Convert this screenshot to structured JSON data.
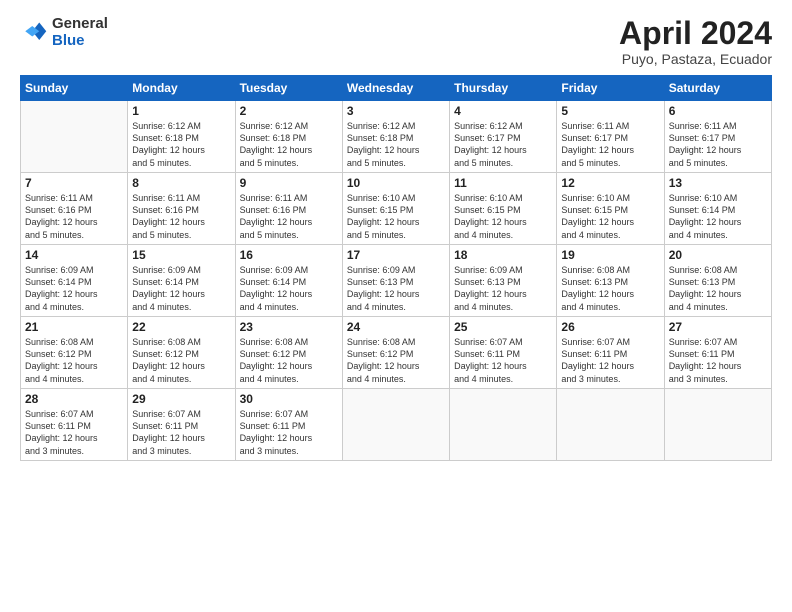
{
  "logo": {
    "general": "General",
    "blue": "Blue"
  },
  "title": {
    "month": "April 2024",
    "location": "Puyo, Pastaza, Ecuador"
  },
  "weekdays": [
    "Sunday",
    "Monday",
    "Tuesday",
    "Wednesday",
    "Thursday",
    "Friday",
    "Saturday"
  ],
  "weeks": [
    [
      {
        "day": "",
        "info": ""
      },
      {
        "day": "1",
        "info": "Sunrise: 6:12 AM\nSunset: 6:18 PM\nDaylight: 12 hours\nand 5 minutes."
      },
      {
        "day": "2",
        "info": "Sunrise: 6:12 AM\nSunset: 6:18 PM\nDaylight: 12 hours\nand 5 minutes."
      },
      {
        "day": "3",
        "info": "Sunrise: 6:12 AM\nSunset: 6:18 PM\nDaylight: 12 hours\nand 5 minutes."
      },
      {
        "day": "4",
        "info": "Sunrise: 6:12 AM\nSunset: 6:17 PM\nDaylight: 12 hours\nand 5 minutes."
      },
      {
        "day": "5",
        "info": "Sunrise: 6:11 AM\nSunset: 6:17 PM\nDaylight: 12 hours\nand 5 minutes."
      },
      {
        "day": "6",
        "info": "Sunrise: 6:11 AM\nSunset: 6:17 PM\nDaylight: 12 hours\nand 5 minutes."
      }
    ],
    [
      {
        "day": "7",
        "info": "Sunrise: 6:11 AM\nSunset: 6:16 PM\nDaylight: 12 hours\nand 5 minutes."
      },
      {
        "day": "8",
        "info": "Sunrise: 6:11 AM\nSunset: 6:16 PM\nDaylight: 12 hours\nand 5 minutes."
      },
      {
        "day": "9",
        "info": "Sunrise: 6:11 AM\nSunset: 6:16 PM\nDaylight: 12 hours\nand 5 minutes."
      },
      {
        "day": "10",
        "info": "Sunrise: 6:10 AM\nSunset: 6:15 PM\nDaylight: 12 hours\nand 5 minutes."
      },
      {
        "day": "11",
        "info": "Sunrise: 6:10 AM\nSunset: 6:15 PM\nDaylight: 12 hours\nand 4 minutes."
      },
      {
        "day": "12",
        "info": "Sunrise: 6:10 AM\nSunset: 6:15 PM\nDaylight: 12 hours\nand 4 minutes."
      },
      {
        "day": "13",
        "info": "Sunrise: 6:10 AM\nSunset: 6:14 PM\nDaylight: 12 hours\nand 4 minutes."
      }
    ],
    [
      {
        "day": "14",
        "info": "Sunrise: 6:09 AM\nSunset: 6:14 PM\nDaylight: 12 hours\nand 4 minutes."
      },
      {
        "day": "15",
        "info": "Sunrise: 6:09 AM\nSunset: 6:14 PM\nDaylight: 12 hours\nand 4 minutes."
      },
      {
        "day": "16",
        "info": "Sunrise: 6:09 AM\nSunset: 6:14 PM\nDaylight: 12 hours\nand 4 minutes."
      },
      {
        "day": "17",
        "info": "Sunrise: 6:09 AM\nSunset: 6:13 PM\nDaylight: 12 hours\nand 4 minutes."
      },
      {
        "day": "18",
        "info": "Sunrise: 6:09 AM\nSunset: 6:13 PM\nDaylight: 12 hours\nand 4 minutes."
      },
      {
        "day": "19",
        "info": "Sunrise: 6:08 AM\nSunset: 6:13 PM\nDaylight: 12 hours\nand 4 minutes."
      },
      {
        "day": "20",
        "info": "Sunrise: 6:08 AM\nSunset: 6:13 PM\nDaylight: 12 hours\nand 4 minutes."
      }
    ],
    [
      {
        "day": "21",
        "info": "Sunrise: 6:08 AM\nSunset: 6:12 PM\nDaylight: 12 hours\nand 4 minutes."
      },
      {
        "day": "22",
        "info": "Sunrise: 6:08 AM\nSunset: 6:12 PM\nDaylight: 12 hours\nand 4 minutes."
      },
      {
        "day": "23",
        "info": "Sunrise: 6:08 AM\nSunset: 6:12 PM\nDaylight: 12 hours\nand 4 minutes."
      },
      {
        "day": "24",
        "info": "Sunrise: 6:08 AM\nSunset: 6:12 PM\nDaylight: 12 hours\nand 4 minutes."
      },
      {
        "day": "25",
        "info": "Sunrise: 6:07 AM\nSunset: 6:11 PM\nDaylight: 12 hours\nand 4 minutes."
      },
      {
        "day": "26",
        "info": "Sunrise: 6:07 AM\nSunset: 6:11 PM\nDaylight: 12 hours\nand 3 minutes."
      },
      {
        "day": "27",
        "info": "Sunrise: 6:07 AM\nSunset: 6:11 PM\nDaylight: 12 hours\nand 3 minutes."
      }
    ],
    [
      {
        "day": "28",
        "info": "Sunrise: 6:07 AM\nSunset: 6:11 PM\nDaylight: 12 hours\nand 3 minutes."
      },
      {
        "day": "29",
        "info": "Sunrise: 6:07 AM\nSunset: 6:11 PM\nDaylight: 12 hours\nand 3 minutes."
      },
      {
        "day": "30",
        "info": "Sunrise: 6:07 AM\nSunset: 6:11 PM\nDaylight: 12 hours\nand 3 minutes."
      },
      {
        "day": "",
        "info": ""
      },
      {
        "day": "",
        "info": ""
      },
      {
        "day": "",
        "info": ""
      },
      {
        "day": "",
        "info": ""
      }
    ]
  ]
}
